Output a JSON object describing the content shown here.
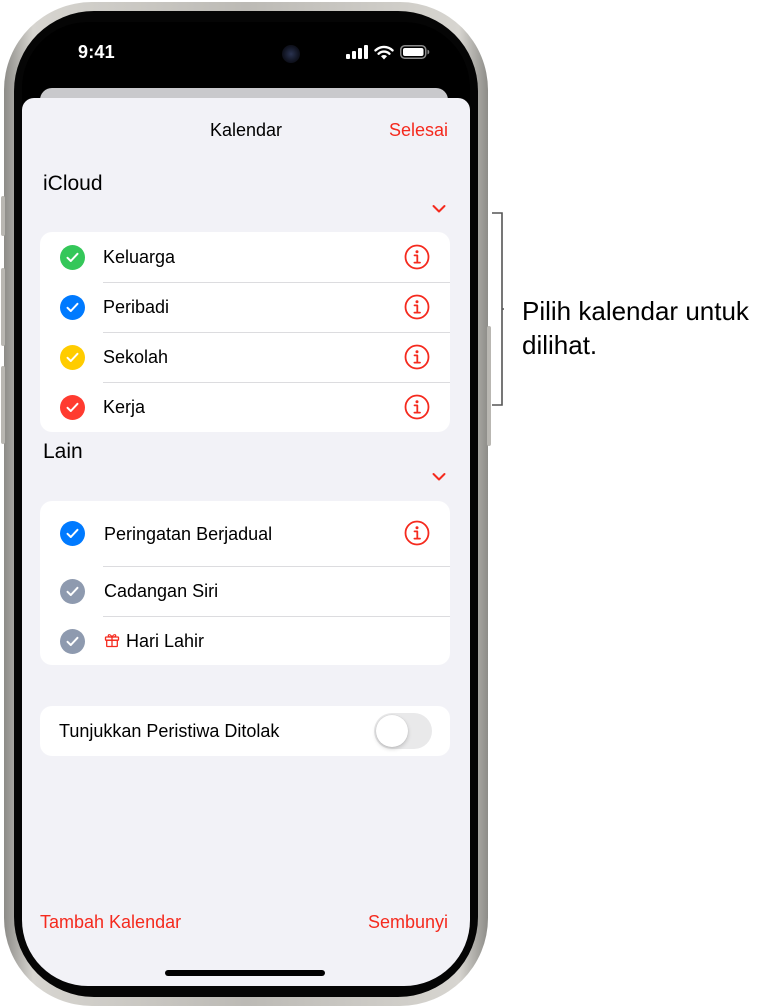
{
  "status_bar": {
    "time": "9:41"
  },
  "nav": {
    "title": "Kalendar",
    "done_label": "Selesai"
  },
  "sections": {
    "icloud": {
      "title": "iCloud",
      "items": [
        {
          "label": "Keluarga",
          "color": "#34c759"
        },
        {
          "label": "Peribadi",
          "color": "#007aff"
        },
        {
          "label": "Sekolah",
          "color": "#ffcc00"
        },
        {
          "label": "Kerja",
          "color": "#ff3b30"
        }
      ]
    },
    "other": {
      "title": "Lain",
      "items": [
        {
          "label": "Peringatan Berjadual",
          "color": "#007aff"
        },
        {
          "label": "Cadangan Siri",
          "color": "#8e9aaf"
        },
        {
          "label": "Hari Lahir",
          "color": "#8e9aaf"
        }
      ]
    }
  },
  "declined": {
    "label": "Tunjukkan Peristiwa Ditolak",
    "enabled": false
  },
  "footer": {
    "add_label": "Tambah Kalendar",
    "hide_label": "Sembunyi"
  },
  "callout": {
    "text": "Pilih kalendar untuk dilihat."
  },
  "colors": {
    "accent": "#f52a1e",
    "sheet_background": "#f2f2f7"
  }
}
